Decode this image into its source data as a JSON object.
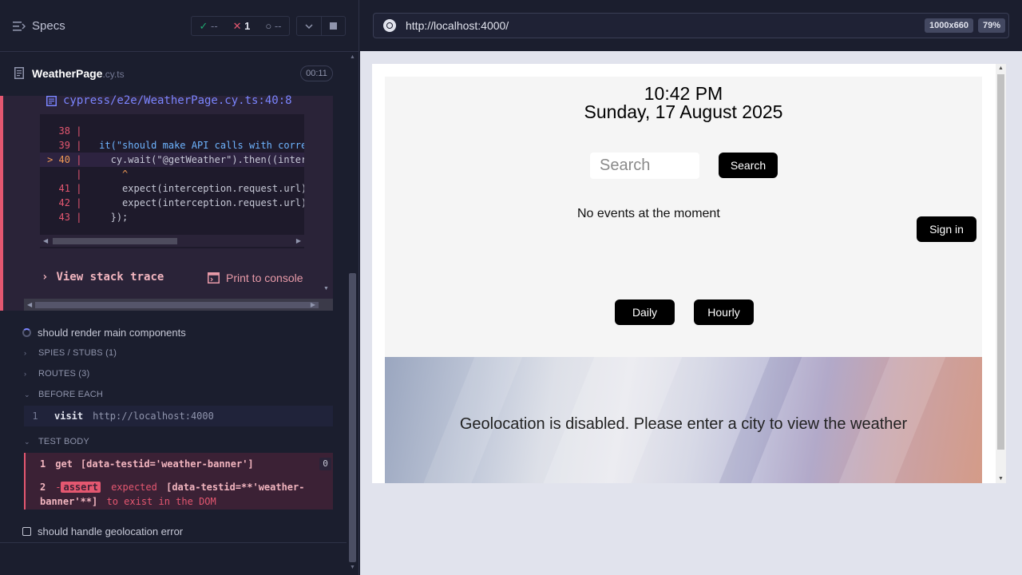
{
  "header": {
    "specs_label": "Specs",
    "stats": {
      "passed": "--",
      "failed": "1",
      "pending": "--"
    }
  },
  "spec": {
    "name": "WeatherPage",
    "ext": ".cy.ts",
    "timer": "00:11"
  },
  "error": {
    "code_path": "cypress/e2e/WeatherPage.cy.ts:40:8",
    "code_lines": [
      {
        "num": "38",
        "code": ""
      },
      {
        "num": "39",
        "code": "  it(\"should make API calls with corre"
      },
      {
        "num": "> 40",
        "code": "    cy.wait(\"@getWeather\").then((interc"
      },
      {
        "num": "",
        "code": "      ^"
      },
      {
        "num": "41",
        "code": "      expect(interception.request.url)"
      },
      {
        "num": "42",
        "code": "      expect(interception.request.url)"
      },
      {
        "num": "43",
        "code": "    });"
      }
    ],
    "view_stack_label": "View stack trace",
    "print_console_label": "Print to console"
  },
  "tests": {
    "running": "should render main components",
    "sections": {
      "spies": "SPIES / STUBS (1)",
      "routes": "ROUTES (3)",
      "before_each": "BEFORE EACH",
      "test_body": "TEST BODY"
    },
    "before_each_cmd": {
      "num": "1",
      "name": "visit",
      "value": "http://localhost:4000"
    },
    "body_cmds": {
      "get": {
        "num": "1",
        "name": "get",
        "value": "[data-testid='weather-banner']",
        "badge": "0"
      },
      "assert": {
        "num": "2",
        "prefix": "-",
        "name": "assert",
        "text1": "expected",
        "text2": "[data-testid=**'weather-banner'**]",
        "text3": "to exist in the DOM"
      }
    },
    "pending": "should handle geolocation error"
  },
  "aut": {
    "url": "http://localhost:4000/",
    "viewport": "1000x660",
    "zoom": "79%",
    "page": {
      "time": "10:42 PM",
      "date": "Sunday, 17 August 2025",
      "search_placeholder": "Search",
      "search_button": "Search",
      "no_events": "No events at the moment",
      "sign_in": "Sign in",
      "daily": "Daily",
      "hourly": "Hourly",
      "banner_text": "Geolocation is disabled. Please enter a city to view the weather"
    }
  },
  "colors": {
    "fail": "#e45770",
    "pass": "#1fa971",
    "accent": "#7b85ff"
  }
}
